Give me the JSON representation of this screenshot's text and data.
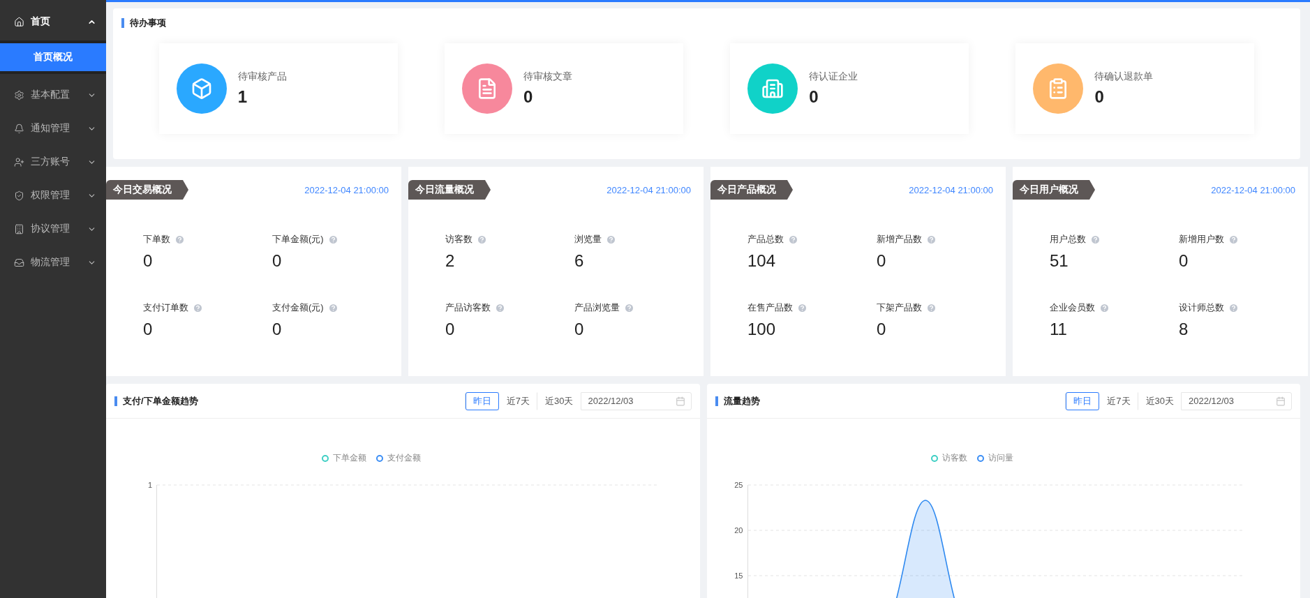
{
  "sidebar": {
    "items": [
      {
        "kind": "home",
        "label": "首页",
        "expanded": true,
        "children": [
          {
            "label": "首页概况",
            "selected": true
          }
        ]
      },
      {
        "kind": "settings",
        "label": "基本配置",
        "expanded": false
      },
      {
        "kind": "notice",
        "label": "通知管理",
        "expanded": false
      },
      {
        "kind": "account",
        "label": "三方账号",
        "expanded": false
      },
      {
        "kind": "permission",
        "label": "权限管理",
        "expanded": false
      },
      {
        "kind": "agreement",
        "label": "协议管理",
        "expanded": false
      },
      {
        "kind": "logistics",
        "label": "物流管理",
        "expanded": false
      }
    ]
  },
  "todo": {
    "title": "待办事项",
    "items": [
      {
        "kind": "product",
        "label": "待审核产品",
        "value": "1",
        "color": "#2aa8ff"
      },
      {
        "kind": "article",
        "label": "待审核文章",
        "value": "0",
        "color": "#f7889c"
      },
      {
        "kind": "company",
        "label": "待认证企业",
        "value": "0",
        "color": "#10d2c8"
      },
      {
        "kind": "refund",
        "label": "待确认退款单",
        "value": "0",
        "color": "#ffb86c"
      }
    ]
  },
  "overview_cards": [
    {
      "title": "今日交易概况",
      "time": "2022-12-04 21:00:00",
      "metrics": [
        {
          "label": "下单数",
          "value": "0"
        },
        {
          "label": "下单金额(元)",
          "value": "0"
        },
        {
          "label": "支付订单数",
          "value": "0"
        },
        {
          "label": "支付金额(元)",
          "value": "0"
        }
      ]
    },
    {
      "title": "今日流量概况",
      "time": "2022-12-04 21:00:00",
      "metrics": [
        {
          "label": "访客数",
          "value": "2"
        },
        {
          "label": "浏览量",
          "value": "6"
        },
        {
          "label": "产品访客数",
          "value": "0"
        },
        {
          "label": "产品浏览量",
          "value": "0"
        }
      ]
    },
    {
      "title": "今日产品概况",
      "time": "2022-12-04 21:00:00",
      "metrics": [
        {
          "label": "产品总数",
          "value": "104"
        },
        {
          "label": "新增产品数",
          "value": "0"
        },
        {
          "label": "在售产品数",
          "value": "100"
        },
        {
          "label": "下架产品数",
          "value": "0"
        }
      ]
    },
    {
      "title": "今日用户概况",
      "time": "2022-12-04 21:00:00",
      "metrics": [
        {
          "label": "用户总数",
          "value": "51"
        },
        {
          "label": "新增用户数",
          "value": "0"
        },
        {
          "label": "企业会员数",
          "value": "11"
        },
        {
          "label": "设计师总数",
          "value": "8"
        }
      ]
    }
  ],
  "trend_panels": [
    {
      "title": "支付/下单金额趋势",
      "ranges": [
        {
          "label": "昨日",
          "selected": true
        },
        {
          "label": "近7天",
          "selected": false
        },
        {
          "label": "近30天",
          "selected": false
        }
      ],
      "date": "2022/12/03",
      "legend": [
        {
          "label": "下单金额",
          "color": "#3fcfc4"
        },
        {
          "label": "支付金额",
          "color": "#3d8ff5"
        }
      ],
      "y_labels": [
        "1"
      ],
      "kind": "flat"
    },
    {
      "title": "流量趋势",
      "ranges": [
        {
          "label": "昨日",
          "selected": true
        },
        {
          "label": "近7天",
          "selected": false
        },
        {
          "label": "近30天",
          "selected": false
        }
      ],
      "date": "2022/12/03",
      "legend": [
        {
          "label": "访客数",
          "color": "#3fcfc4"
        },
        {
          "label": "访问量",
          "color": "#3d8ff5"
        }
      ],
      "y_labels": [
        "25",
        "20",
        "15"
      ],
      "kind": "peak"
    }
  ]
}
